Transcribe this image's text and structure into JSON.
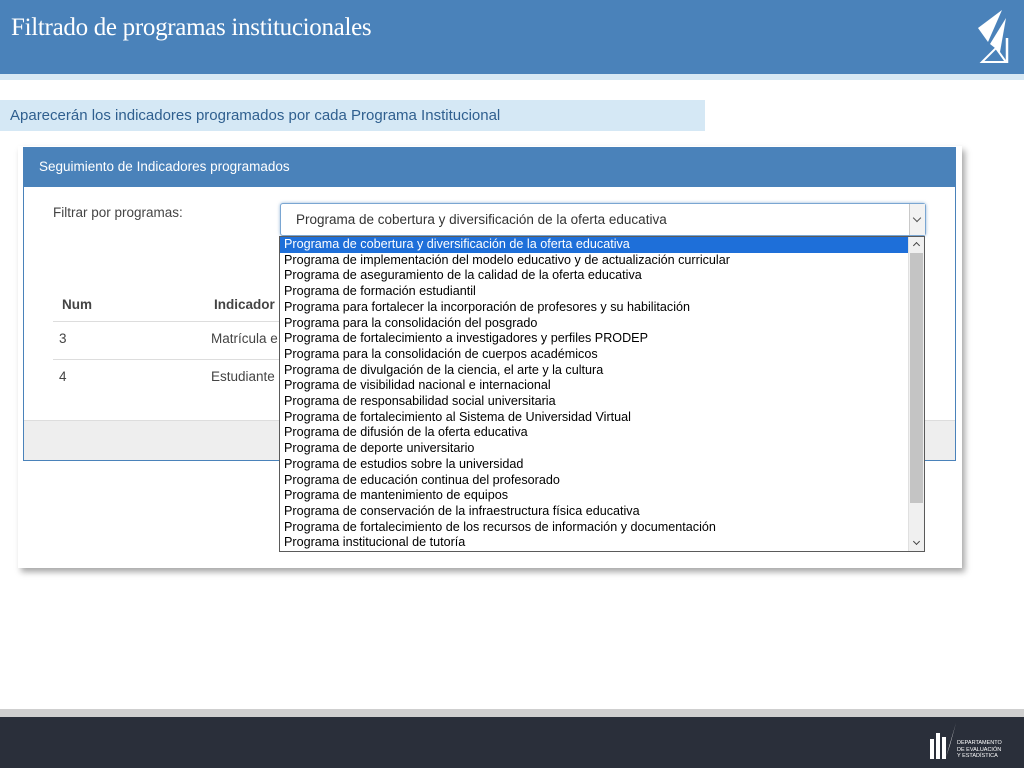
{
  "slide": {
    "title": "Filtrado de programas institucionales",
    "banner": "Aparecerán los indicadores programados por cada Programa Institucional"
  },
  "panel": {
    "header": "Seguimiento de Indicadores programados",
    "filter_label": "Filtrar por programas:",
    "selected_program": "Programa de cobertura y diversificación de la oferta educativa",
    "table": {
      "columns": [
        "Num",
        "Indicador"
      ],
      "rows": [
        {
          "num": "3",
          "indicador": "Matrícula e"
        },
        {
          "num": "4",
          "indicador": "Estudiante"
        }
      ]
    }
  },
  "dropdown": {
    "options": [
      "Programa de cobertura y diversificación de la oferta educativa",
      "Programa de implementación del modelo educativo y de actualización curricular",
      "Programa de aseguramiento de la calidad de la oferta educativa",
      "Programa de formación estudiantil",
      "Programa para fortalecer la incorporación de profesores y su habilitación",
      "Programa para la consolidación del posgrado",
      "Programa de fortalecimiento a investigadores y perfiles PRODEP",
      "Programa para la consolidación de cuerpos académicos",
      "Programa de divulgación de la ciencia, el arte y la cultura",
      "Programa de visibilidad nacional e internacional",
      "Programa de responsabilidad social universitaria",
      "Programa de fortalecimiento al Sistema de Universidad Virtual",
      "Programa de difusión de la oferta educativa",
      "Programa de deporte universitario",
      "Programa de estudios sobre la universidad",
      "Programa de educación continua del profesorado",
      "Programa de mantenimiento de equipos",
      "Programa de conservación de la infraestructura física educativa",
      "Programa de fortalecimiento de los recursos de información y documentación",
      "Programa institucional de tutoría"
    ],
    "selected_index": 0
  },
  "footer": {
    "org_line1": "DEPARTAMENTO",
    "org_line2": "DE EVALUACIÓN",
    "org_line3": "Y ESTADÍSTICA"
  },
  "icons": {
    "header_logo": "university-logo-icon",
    "footer_logo": "department-logo-icon"
  },
  "colors": {
    "header_blue": "#4a82ba",
    "banner_bg": "#d5e8f5",
    "selection_blue": "#1e6fd9",
    "footer_dark": "#2a2f3a"
  }
}
